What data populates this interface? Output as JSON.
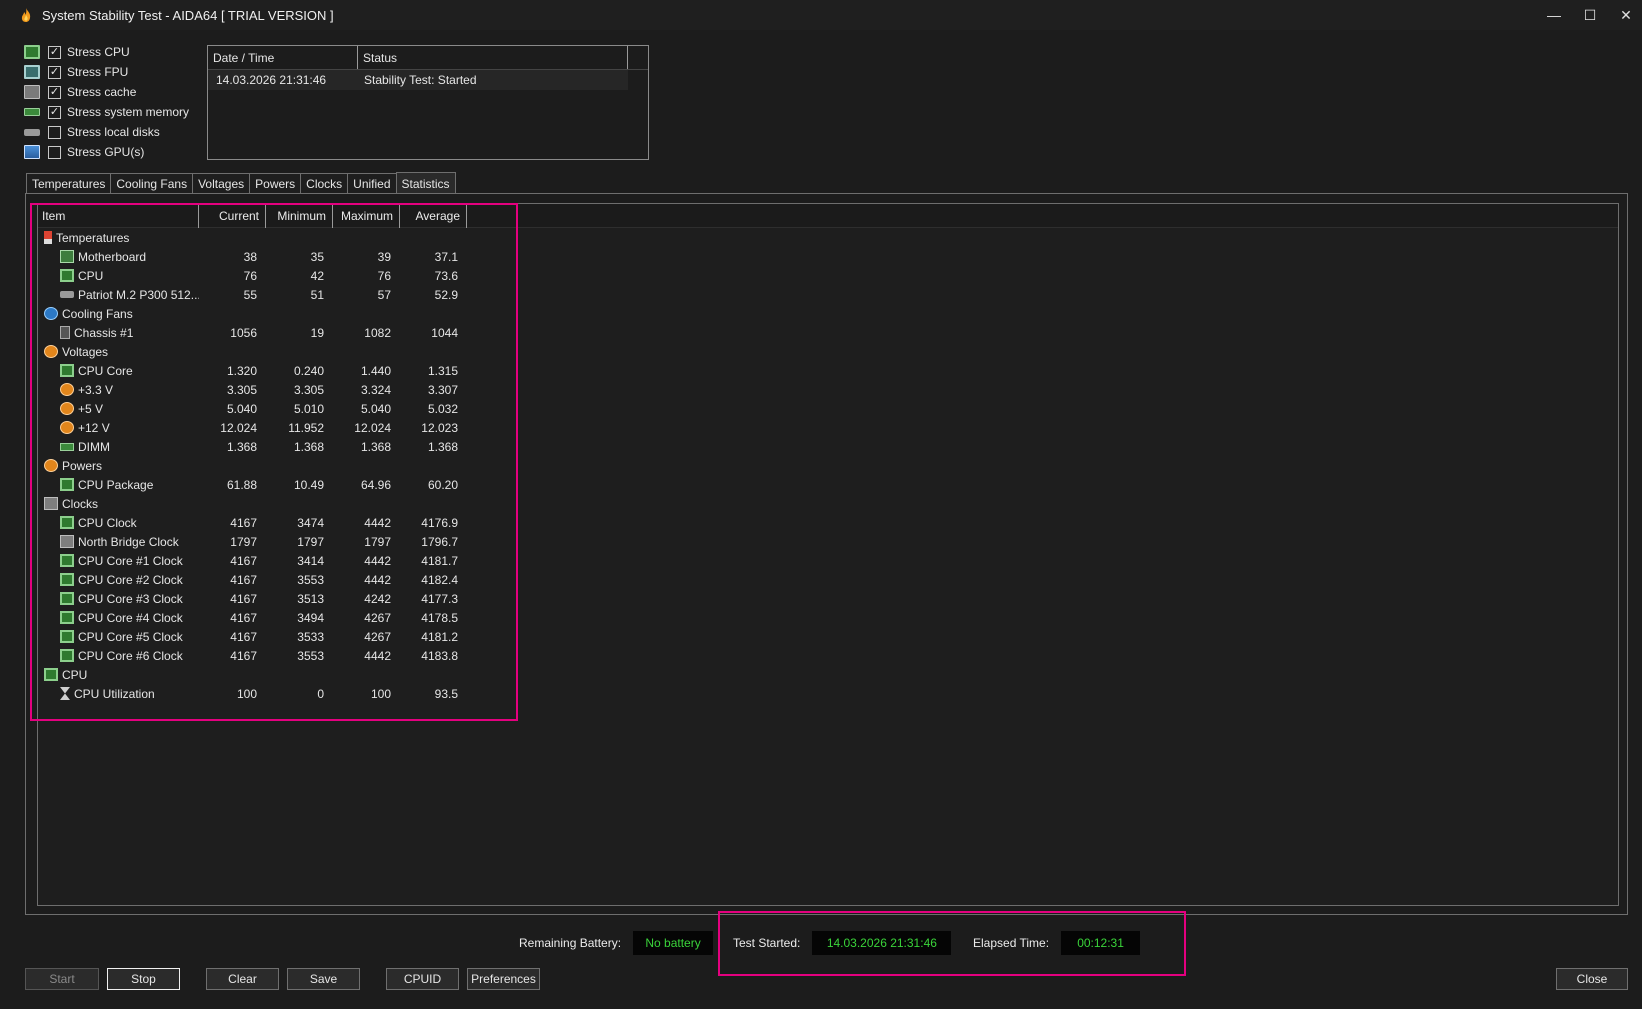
{
  "window": {
    "title": "System Stability Test - AIDA64  [ TRIAL VERSION ]",
    "controls": {
      "minimize": "—",
      "maximize": "☐",
      "close": "✕"
    }
  },
  "stress_options": [
    {
      "label": "Stress CPU",
      "checked": true,
      "icon": "cpu-chip-icon"
    },
    {
      "label": "Stress FPU",
      "checked": true,
      "icon": "fpu-chip-icon"
    },
    {
      "label": "Stress cache",
      "checked": true,
      "icon": "cache-icon"
    },
    {
      "label": "Stress system memory",
      "checked": true,
      "icon": "memory-icon"
    },
    {
      "label": "Stress local disks",
      "checked": false,
      "icon": "disk-icon"
    },
    {
      "label": "Stress GPU(s)",
      "checked": false,
      "icon": "gpu-icon"
    }
  ],
  "log": {
    "headers": [
      "Date / Time",
      "Status"
    ],
    "rows": [
      {
        "datetime": "14.03.2026 21:31:46",
        "status": "Stability Test: Started"
      }
    ]
  },
  "tabs": [
    "Temperatures",
    "Cooling Fans",
    "Voltages",
    "Powers",
    "Clocks",
    "Unified",
    "Statistics"
  ],
  "active_tab": "Statistics",
  "stats": {
    "headers": {
      "item": "Item",
      "current": "Current",
      "minimum": "Minimum",
      "maximum": "Maximum",
      "average": "Average"
    },
    "groups": [
      {
        "name": "Temperatures",
        "icon": "thermometer-icon",
        "items": [
          {
            "name": "Motherboard",
            "icon": "motherboard-icon",
            "current": "38",
            "min": "35",
            "max": "39",
            "avg": "37.1"
          },
          {
            "name": "CPU",
            "icon": "cpu-icon",
            "current": "76",
            "min": "42",
            "max": "76",
            "avg": "73.6"
          },
          {
            "name": "Patriot M.2 P300 512...",
            "icon": "disk-icon",
            "current": "55",
            "min": "51",
            "max": "57",
            "avg": "52.9"
          }
        ]
      },
      {
        "name": "Cooling Fans",
        "icon": "fan-icon",
        "items": [
          {
            "name": "Chassis #1",
            "icon": "chassis-icon",
            "current": "1056",
            "min": "19",
            "max": "1082",
            "avg": "1044"
          }
        ]
      },
      {
        "name": "Voltages",
        "icon": "voltage-icon",
        "items": [
          {
            "name": "CPU Core",
            "icon": "cpu-icon",
            "current": "1.320",
            "min": "0.240",
            "max": "1.440",
            "avg": "1.315"
          },
          {
            "name": "+3.3 V",
            "icon": "voltage-icon",
            "current": "3.305",
            "min": "3.305",
            "max": "3.324",
            "avg": "3.307"
          },
          {
            "name": "+5 V",
            "icon": "voltage-icon",
            "current": "5.040",
            "min": "5.010",
            "max": "5.040",
            "avg": "5.032"
          },
          {
            "name": "+12 V",
            "icon": "voltage-icon",
            "current": "12.024",
            "min": "11.952",
            "max": "12.024",
            "avg": "12.023"
          },
          {
            "name": "DIMM",
            "icon": "dimm-icon",
            "current": "1.368",
            "min": "1.368",
            "max": "1.368",
            "avg": "1.368"
          }
        ]
      },
      {
        "name": "Powers",
        "icon": "power-icon",
        "items": [
          {
            "name": "CPU Package",
            "icon": "cpu-icon",
            "current": "61.88",
            "min": "10.49",
            "max": "64.96",
            "avg": "60.20"
          }
        ]
      },
      {
        "name": "Clocks",
        "icon": "clock-icon",
        "items": [
          {
            "name": "CPU Clock",
            "icon": "cpu-icon",
            "current": "4167",
            "min": "3474",
            "max": "4442",
            "avg": "4176.9"
          },
          {
            "name": "North Bridge Clock",
            "icon": "northbridge-icon",
            "current": "1797",
            "min": "1797",
            "max": "1797",
            "avg": "1796.7"
          },
          {
            "name": "CPU Core #1 Clock",
            "icon": "cpu-icon",
            "current": "4167",
            "min": "3414",
            "max": "4442",
            "avg": "4181.7"
          },
          {
            "name": "CPU Core #2 Clock",
            "icon": "cpu-icon",
            "current": "4167",
            "min": "3553",
            "max": "4442",
            "avg": "4182.4"
          },
          {
            "name": "CPU Core #3 Clock",
            "icon": "cpu-icon",
            "current": "4167",
            "min": "3513",
            "max": "4242",
            "avg": "4177.3"
          },
          {
            "name": "CPU Core #4 Clock",
            "icon": "cpu-icon",
            "current": "4167",
            "min": "3494",
            "max": "4267",
            "avg": "4178.5"
          },
          {
            "name": "CPU Core #5 Clock",
            "icon": "cpu-icon",
            "current": "4167",
            "min": "3533",
            "max": "4267",
            "avg": "4181.2"
          },
          {
            "name": "CPU Core #6 Clock",
            "icon": "cpu-icon",
            "current": "4167",
            "min": "3553",
            "max": "4442",
            "avg": "4183.8"
          }
        ]
      },
      {
        "name": "CPU",
        "icon": "cpu-icon",
        "items": [
          {
            "name": "CPU Utilization",
            "icon": "hourglass-icon",
            "current": "100",
            "min": "0",
            "max": "100",
            "avg": "93.5"
          }
        ]
      }
    ]
  },
  "status": {
    "battery_label": "Remaining Battery:",
    "battery_value": "No battery",
    "started_label": "Test Started:",
    "started_value": "14.03.2026 21:31:46",
    "elapsed_label": "Elapsed Time:",
    "elapsed_value": "00:12:31"
  },
  "buttons": {
    "start": "Start",
    "stop": "Stop",
    "clear": "Clear",
    "save": "Save",
    "cpuid": "CPUID",
    "preferences": "Preferences",
    "close": "Close"
  },
  "colors": {
    "background": "#1c1c1c",
    "highlight": "#e4007f",
    "status_value_text": "#3ad33a"
  }
}
